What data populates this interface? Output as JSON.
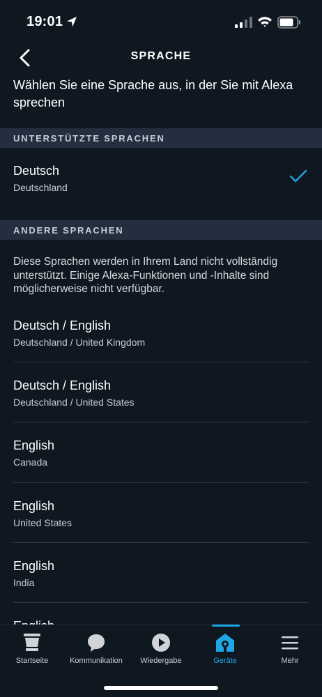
{
  "status": {
    "time": "19:01"
  },
  "header": {
    "title": "SPRACHE"
  },
  "intro": "Wählen Sie eine Sprache aus, in der Sie mit Alexa sprechen",
  "supported": {
    "header": "UNTERSTÜTZTE SPRACHEN",
    "items": [
      {
        "name": "Deutsch",
        "region": "Deutschland",
        "selected": true
      }
    ]
  },
  "other": {
    "header": "ANDERE SPRACHEN",
    "note": "Diese Sprachen werden in Ihrem Land nicht vollständig unterstützt. Einige Alexa-Funktionen und -Inhalte sind möglicherweise nicht verfügbar.",
    "items": [
      {
        "name": "Deutsch / English",
        "region": "Deutschland / United Kingdom"
      },
      {
        "name": "Deutsch / English",
        "region": "Deutschland / United States"
      },
      {
        "name": "English",
        "region": "Canada"
      },
      {
        "name": "English",
        "region": "United States"
      },
      {
        "name": "English",
        "region": "India"
      },
      {
        "name": "English",
        "region": ""
      }
    ]
  },
  "tabs": [
    {
      "label": "Startseite",
      "icon": "home-icon"
    },
    {
      "label": "Kommunikation",
      "icon": "chat-icon"
    },
    {
      "label": "Wiedergabe",
      "icon": "play-icon"
    },
    {
      "label": "Geräte",
      "icon": "devices-icon",
      "active": true
    },
    {
      "label": "Mehr",
      "icon": "menu-icon"
    }
  ],
  "colors": {
    "background": "#0f1821",
    "section": "#232f3e",
    "accent": "#1fa6e5"
  }
}
